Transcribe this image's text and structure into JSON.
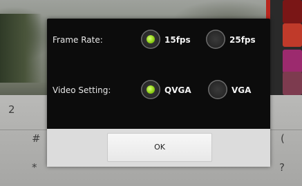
{
  "dialog": {
    "frame_rate": {
      "label": "Frame Rate:",
      "options": [
        {
          "label": "15fps",
          "selected": true
        },
        {
          "label": "25fps",
          "selected": false
        }
      ]
    },
    "video_setting": {
      "label": "Video Setting:",
      "options": [
        {
          "label": "QVGA",
          "selected": true
        },
        {
          "label": "VGA",
          "selected": false
        }
      ]
    },
    "ok_label": "OK"
  },
  "keypad": {
    "keys": [
      "2",
      "#",
      "*",
      "(",
      "?"
    ]
  },
  "colors": {
    "accent_selected": "#93d318",
    "dialog_bg": "#0c0c0c",
    "button_bar_bg": "#dcdcdc"
  }
}
